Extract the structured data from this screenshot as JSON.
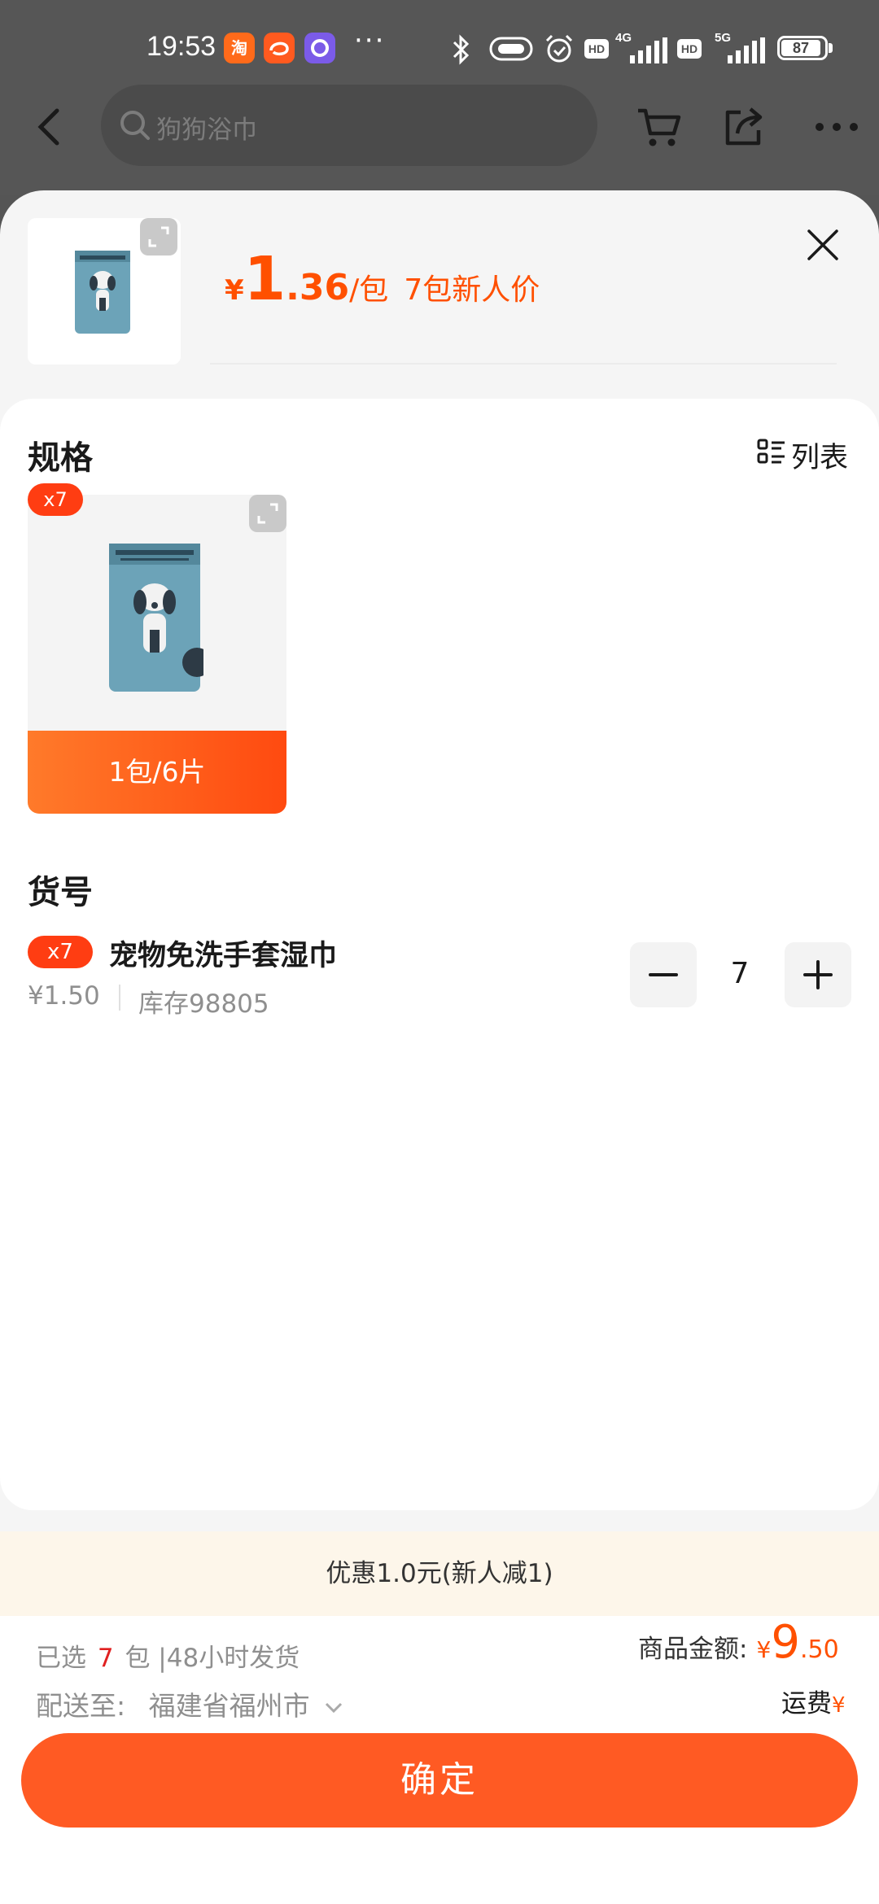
{
  "status_bar": {
    "time": "19:53",
    "apps": [
      "淘",
      "",
      "O"
    ],
    "more": "···",
    "net1": "4G",
    "net2": "5G",
    "hd": "HD",
    "battery": "87"
  },
  "nav": {
    "search_placeholder": "狗狗浴巾"
  },
  "product": {
    "currency": "¥",
    "price_int": "1",
    "price_dec": ".36",
    "unit": "/包",
    "promo_label": "7包新人价"
  },
  "spec": {
    "title": "规格",
    "list_toggle": "列表",
    "badge": "x7",
    "option_label": "1包/6片"
  },
  "sku": {
    "title": "货号",
    "badge": "x7",
    "name": "宠物免洗手套湿巾",
    "price": "¥1.50",
    "stock": "库存98805",
    "quantity": "7"
  },
  "promo": {
    "text": "优惠1.0元(新人减1)"
  },
  "footer": {
    "selected_prefix": "已选",
    "selected_count": "7",
    "selected_suffix": "包 |48小时发货",
    "deliver_label": "配送至:",
    "deliver_location": "福建省福州市",
    "amount_label": "商品金额:",
    "amount_currency": "¥",
    "amount_int": "9",
    "amount_dec": ".50",
    "shipping_label": "运费",
    "shipping_currency": "¥",
    "confirm": "确定"
  },
  "colors": {
    "accent": "#ff5000",
    "button": "#ff5a23",
    "promo_bg": "#fdf6ea"
  }
}
